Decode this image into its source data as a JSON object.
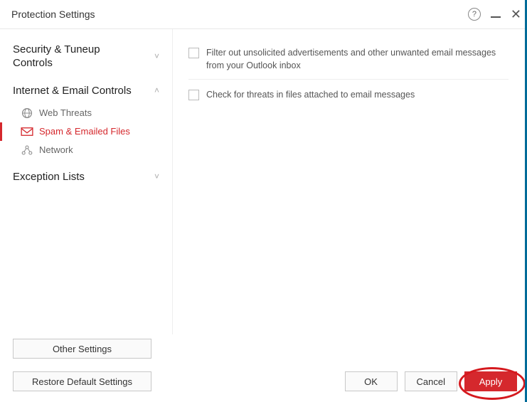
{
  "title": "Protection Settings",
  "sidebar": {
    "sections": [
      {
        "label": "Security & Tuneup Controls",
        "chev": "˅"
      },
      {
        "label": "Internet & Email Controls",
        "chev": "˄"
      },
      {
        "label": "Exception Lists",
        "chev": "˅"
      }
    ],
    "items": [
      {
        "label": "Web Threats"
      },
      {
        "label": "Spam & Emailed Files"
      },
      {
        "label": "Network"
      }
    ],
    "other_settings": "Other Settings",
    "restore": "Restore Default Settings"
  },
  "settings": [
    {
      "text": "Filter out unsolicited advertisements and other unwanted email messages from your Outlook inbox"
    },
    {
      "text": "Check for threats in files attached to email messages"
    }
  ],
  "buttons": {
    "ok": "OK",
    "cancel": "Cancel",
    "apply": "Apply"
  }
}
